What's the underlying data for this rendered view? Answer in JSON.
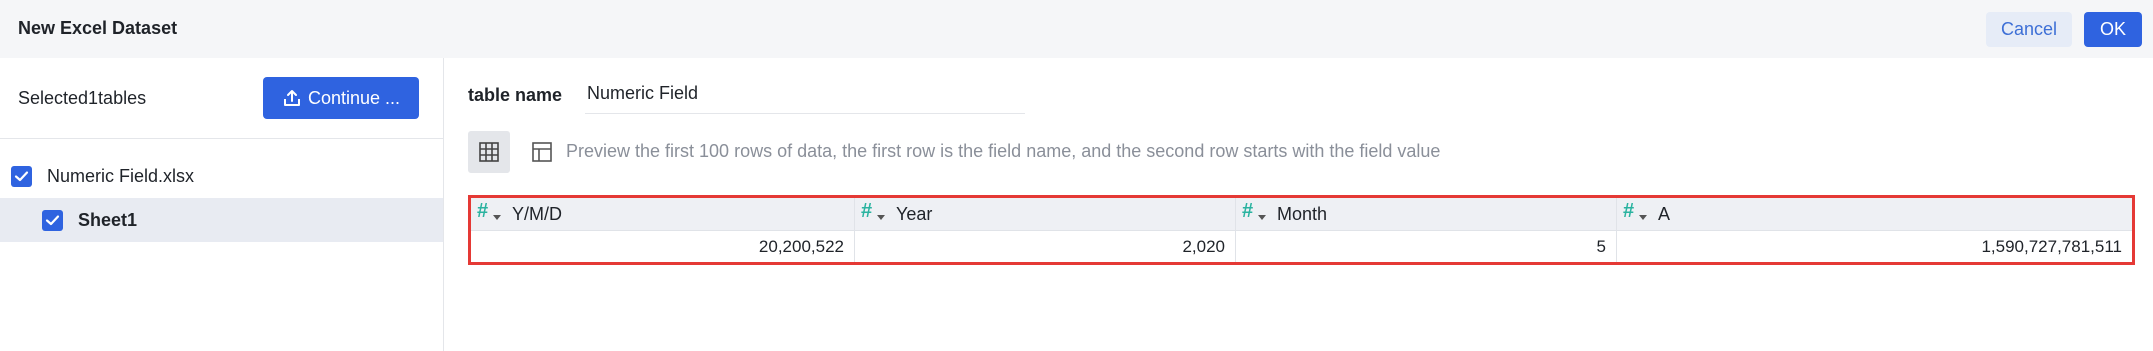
{
  "header": {
    "title": "New Excel Dataset",
    "cancel_label": "Cancel",
    "ok_label": "OK"
  },
  "sidebar": {
    "selected_text": "Selected1tables",
    "continue_label": "Continue ...",
    "continue_icon": "upload-icon",
    "file": {
      "name": "Numeric Field.xlsx",
      "checked": true
    },
    "sheet": {
      "name": "Sheet1",
      "checked": true
    }
  },
  "main": {
    "table_name_label": "table name",
    "table_name_value": "Numeric Field",
    "hint": "Preview the first 100 rows of data, the first row is the field name, and the second row starts with the field value",
    "columns": [
      {
        "name": "Y/M/D",
        "type_icon": "#"
      },
      {
        "name": "Year",
        "type_icon": "#"
      },
      {
        "name": "Month",
        "type_icon": "#"
      },
      {
        "name": "A",
        "type_icon": "#"
      }
    ],
    "rows": [
      [
        "20,200,522",
        "2,020",
        "5",
        "1,590,727,781,511"
      ]
    ]
  },
  "colors": {
    "primary": "#2f63e0",
    "highlight_border": "#e53935",
    "numeric_icon": "#2ab3a0",
    "selected_row_bg": "#e8ebf2"
  }
}
